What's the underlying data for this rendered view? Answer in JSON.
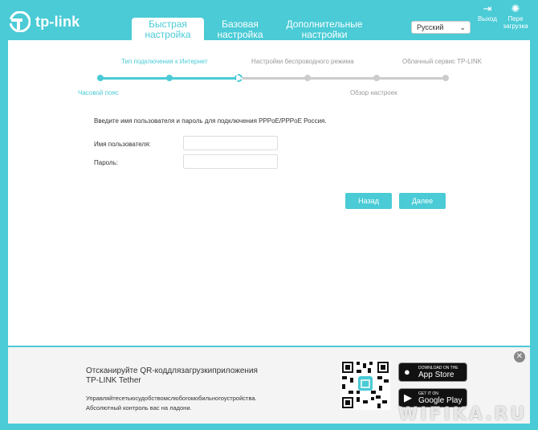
{
  "brand": {
    "logo_text": "tp-link"
  },
  "tabs": [
    {
      "label": "Быстрая настройка",
      "active": true
    },
    {
      "label": "Базовая настройка",
      "active": false
    },
    {
      "label": "Дополнительные настройки",
      "active": false
    }
  ],
  "language": {
    "selected": "Русский"
  },
  "top_actions": {
    "logout": "Выход",
    "reboot": "Пере загрузка"
  },
  "wizard": {
    "steps_top": [
      "Тип подключения к Интернет",
      "Настройки беспроводного режима",
      "Облачный сервис TP-LINK"
    ],
    "steps_bottom": [
      "Часовой пояс",
      "Обзор настроек"
    ],
    "current_step": 3,
    "total_steps": 6
  },
  "form": {
    "instruction": "Введите имя пользователя и пароль для подключения PPPoE/PPPoE Россия.",
    "username_label": "Имя пользователя:",
    "username_value": "",
    "password_label": "Пароль:",
    "password_value": "",
    "back_label": "Назад",
    "next_label": "Далее"
  },
  "footer": {
    "title": "Отсканируйте QR-коддлязагрузкиприложенияTP-LINK Tether",
    "desc_line1": "Управляйтесетьюсудобствомслюбогомобильногоустройства.",
    "desc_line2": "Абсолютный контроль вас на ладони.",
    "appstore_small": "DOWNLOAD ON THE",
    "appstore_big": "App Store",
    "gplay_small": "GET IT ON",
    "gplay_big": "Google Play"
  },
  "watermark": "WIFIKA.RU",
  "colors": {
    "accent": "#4acbd6",
    "inactive": "#cccccc"
  }
}
